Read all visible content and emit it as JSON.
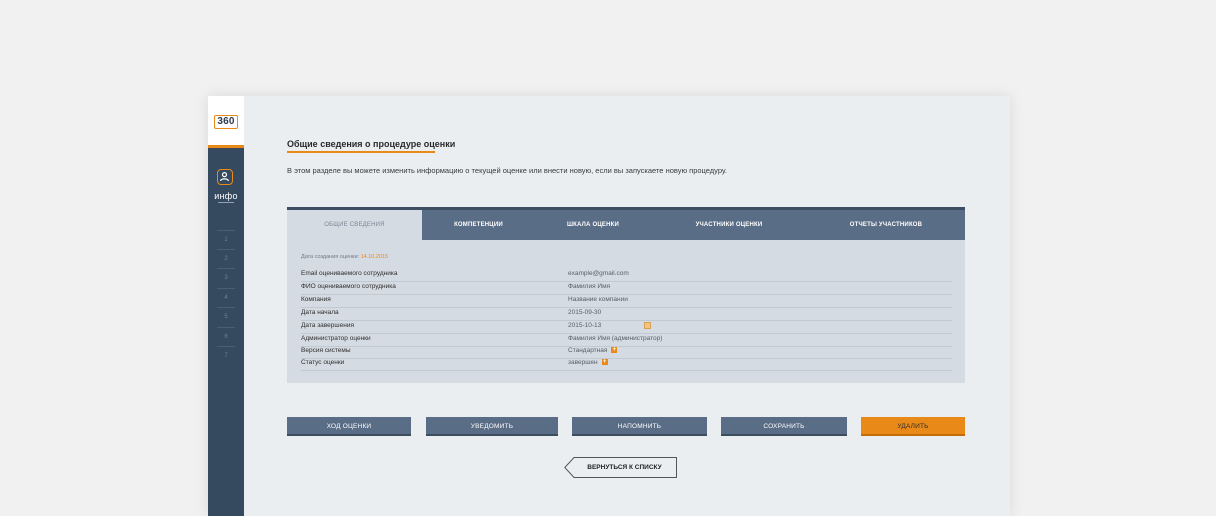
{
  "sidebar": {
    "logo": "360",
    "nav_info_label": "инфо",
    "steps": [
      "1",
      "2",
      "3",
      "4",
      "5",
      "6",
      "7"
    ]
  },
  "main": {
    "title": "Общие сведения о процедуре оценки",
    "description": "В этом разделе вы можете изменить информацию о текущей оценке или внести новую, если вы запускаете новую процедуру."
  },
  "tabs": [
    "Общие сведения",
    "Компетенции",
    "Шкала оценки",
    "Участники оценки",
    "Отчеты участников"
  ],
  "info": {
    "created_label": "Дата создания оценки:",
    "created_date": "14.10.2015",
    "rows": [
      {
        "key": "Email оцениваемого сотрудника",
        "value": "example@gmail.com"
      },
      {
        "key": "ФИО оцениваемого сотрудника",
        "value": "Фамилия Имя"
      },
      {
        "key": "Компания",
        "value": "Название компании"
      },
      {
        "key": "Дата начала",
        "value": "2015-09-30"
      },
      {
        "key": "Дата завершения",
        "value": "2015-10-13"
      },
      {
        "key": "Администратор оценки",
        "value": "Фамилия Имя (администратор)"
      },
      {
        "key": "Версия системы",
        "value": "Стандартная"
      },
      {
        "key": "Статус оценки",
        "value": "завершен"
      }
    ]
  },
  "buttons": {
    "progress": "Ход оценки",
    "notify": "Уведомить",
    "remind": "Напомнить",
    "save": "Сохранить",
    "delete": "Удалить",
    "back": "Вернуться к списку"
  },
  "colors": {
    "accent": "#e98a18",
    "sidebar": "#35495f",
    "tab_bar": "#5a6d86",
    "panel": "#d5dbe2"
  },
  "icons": {
    "nav_info": "user-icon",
    "calendar": "calendar-icon",
    "expand": "plus-icon",
    "back": "arrow-left-icon"
  }
}
